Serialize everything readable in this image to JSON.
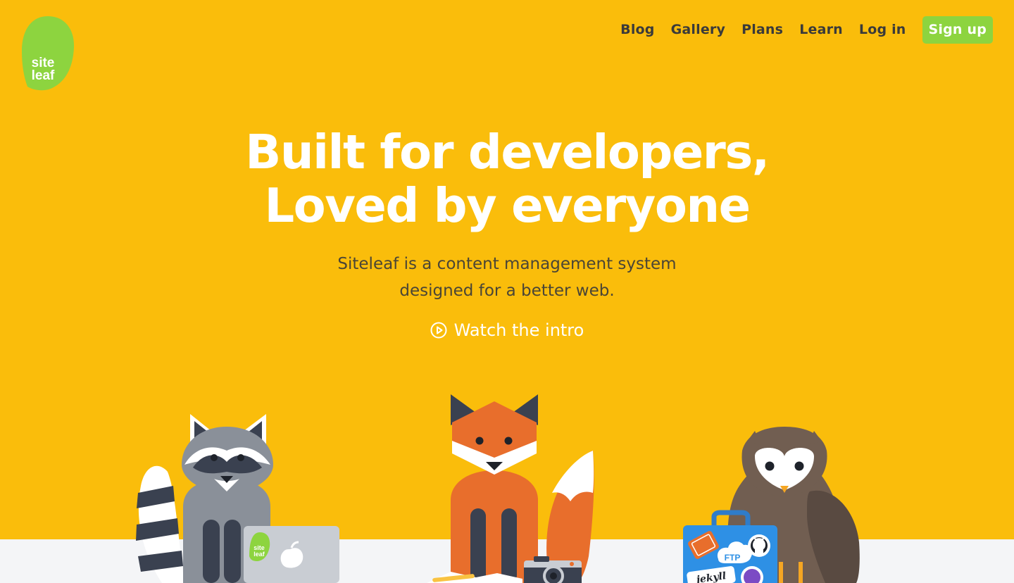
{
  "brand": {
    "logo_line1": "site",
    "logo_line2": "leaf",
    "logo_color": "#8DD43F",
    "background": "#FABD0B"
  },
  "nav": {
    "items": [
      {
        "label": "Blog"
      },
      {
        "label": "Gallery"
      },
      {
        "label": "Plans"
      },
      {
        "label": "Learn"
      },
      {
        "label": "Log in"
      }
    ],
    "signup_label": "Sign up",
    "signup_color": "#8DD43F"
  },
  "hero": {
    "title_line1": "Built for developers,",
    "title_line2": "Loved by everyone",
    "subtitle_line1": "Siteleaf is a content management system",
    "subtitle_line2": "designed for a better web.",
    "watch_label": "Watch the intro",
    "watch_icon": "play-circle-icon"
  },
  "illustration": {
    "laptop_sticker_line1": "site",
    "laptop_sticker_line2": "leaf",
    "suitcase_sticker_ftp": "FTP",
    "suitcase_sticker_jekyll": "jekyll"
  }
}
